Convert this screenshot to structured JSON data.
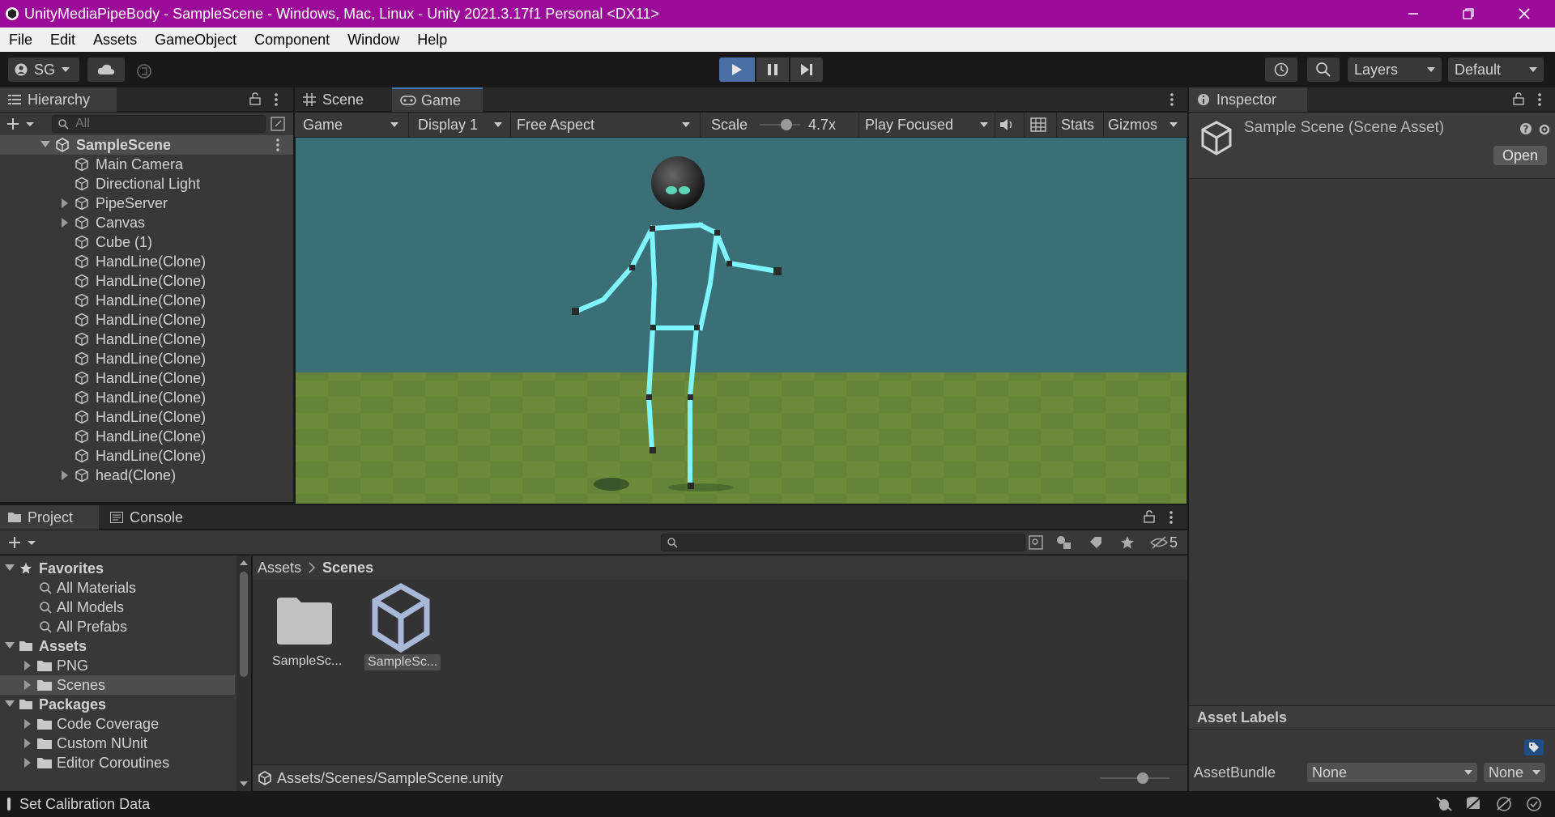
{
  "window": {
    "title": "UnityMediaPipeBody - SampleScene - Windows, Mac, Linux - Unity 2021.3.17f1 Personal <DX11>"
  },
  "menu": [
    "File",
    "Edit",
    "Assets",
    "GameObject",
    "Component",
    "Window",
    "Help"
  ],
  "toolbar": {
    "account": "SG",
    "layers": "Layers",
    "layout": "Default"
  },
  "hierarchy": {
    "tab": "Hierarchy",
    "search_placeholder": "All",
    "scene": "SampleScene",
    "items": [
      {
        "label": "Main Camera",
        "expandable": false
      },
      {
        "label": "Directional Light",
        "expandable": false
      },
      {
        "label": "PipeServer",
        "expandable": true
      },
      {
        "label": "Canvas",
        "expandable": true
      },
      {
        "label": "Cube (1)",
        "expandable": false
      },
      {
        "label": "HandLine(Clone)",
        "expandable": false
      },
      {
        "label": "HandLine(Clone)",
        "expandable": false
      },
      {
        "label": "HandLine(Clone)",
        "expandable": false
      },
      {
        "label": "HandLine(Clone)",
        "expandable": false
      },
      {
        "label": "HandLine(Clone)",
        "expandable": false
      },
      {
        "label": "HandLine(Clone)",
        "expandable": false
      },
      {
        "label": "HandLine(Clone)",
        "expandable": false
      },
      {
        "label": "HandLine(Clone)",
        "expandable": false
      },
      {
        "label": "HandLine(Clone)",
        "expandable": false
      },
      {
        "label": "HandLine(Clone)",
        "expandable": false
      },
      {
        "label": "HandLine(Clone)",
        "expandable": false
      },
      {
        "label": "head(Clone)",
        "expandable": true
      }
    ]
  },
  "game": {
    "tabs": [
      "Scene",
      "Game"
    ],
    "mode": "Game",
    "display": "Display 1",
    "aspect": "Free Aspect",
    "scale_label": "Scale",
    "scale_value": "4.7x",
    "play_mode": "Play Focused",
    "stats": "Stats",
    "gizmos": "Gizmos"
  },
  "inspector": {
    "tab": "Inspector",
    "title": "Sample Scene (Scene Asset)",
    "open": "Open",
    "asset_labels": "Asset Labels",
    "assetbundle_label": "AssetBundle",
    "assetbundle_value": "None",
    "variant_value": "None"
  },
  "project": {
    "tabs": [
      "Project",
      "Console"
    ],
    "favorites_label": "Favorites",
    "favorites": [
      "All Materials",
      "All Models",
      "All Prefabs"
    ],
    "assets_label": "Assets",
    "assets": [
      "PNG",
      "Scenes"
    ],
    "packages_label": "Packages",
    "packages": [
      "Code Coverage",
      "Custom NUnit",
      "Editor Coroutines"
    ],
    "breadcrumb": [
      "Assets",
      "Scenes"
    ],
    "files": [
      "SampleSc...",
      "SampleSc..."
    ],
    "hidden_count": "5",
    "path": "Assets/Scenes/SampleScene.unity"
  },
  "status": {
    "message": "Set Calibration Data"
  }
}
